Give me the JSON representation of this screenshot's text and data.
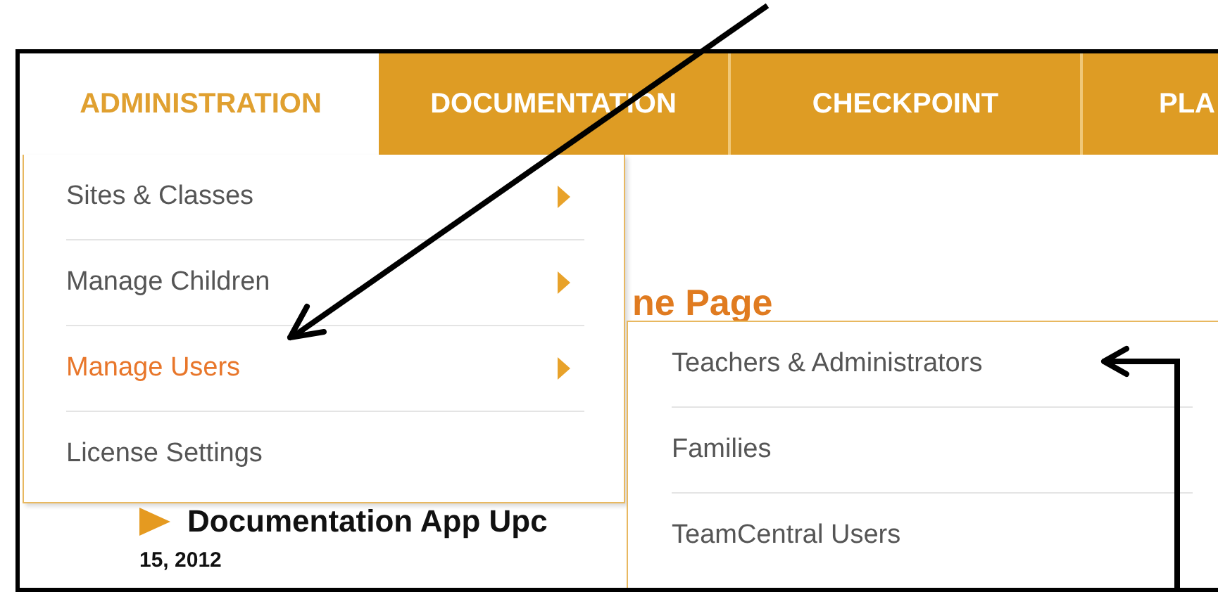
{
  "nav_tabs": [
    {
      "label": "ADMINISTRATION",
      "selected": true
    },
    {
      "label": "DOCUMENTATION",
      "selected": false
    },
    {
      "label": "CHECKPOINT",
      "selected": false
    },
    {
      "label": "PLA",
      "selected": false
    }
  ],
  "menu": {
    "items": [
      {
        "label": "Sites & Classes",
        "has_submenu": true,
        "selected": false
      },
      {
        "label": "Manage Children",
        "has_submenu": true,
        "selected": false
      },
      {
        "label": "Manage Users",
        "has_submenu": true,
        "selected": true
      },
      {
        "label": "License Settings",
        "has_submenu": false,
        "selected": false
      }
    ]
  },
  "submenu": {
    "items": [
      {
        "label": "Teachers & Administrators"
      },
      {
        "label": "Families"
      },
      {
        "label": "TeamCentral Users"
      }
    ]
  },
  "page": {
    "heading": "ne Page",
    "news": [
      {
        "title": "Documentation App Upc",
        "date": "15, 2012"
      }
    ]
  }
}
